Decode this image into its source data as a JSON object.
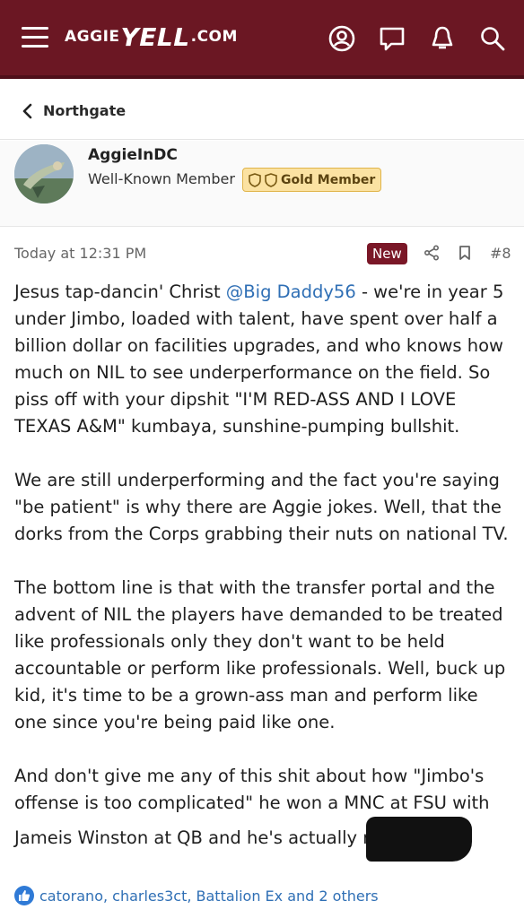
{
  "header": {
    "logo_left": "AGGIE",
    "logo_mid": "YELL",
    "logo_right": ".COM"
  },
  "breadcrumb": {
    "label": "Northgate"
  },
  "author": {
    "username": "AggieInDC",
    "title": "Well-Known Member",
    "badge": "Gold Member"
  },
  "post": {
    "timestamp": "Today at 12:31 PM",
    "new_label": "New",
    "post_number": "#8",
    "p1_before": "Jesus tap-dancin' Christ ",
    "p1_mention": "@Big Daddy56",
    "p1_after": " - we're in year 5 under Jimbo, loaded with talent, have spent over half a billion dollar on facilities upgrades, and who knows how much on NIL to see underperformance on the field. So piss off with your dipshit \"I'M RED-ASS AND I LOVE TEXAS A&M\" kumbaya, sunshine-pumping bullshit.",
    "p2": "We are still underperforming and the fact you're saying \"be patient\" is why there are Aggie jokes. Well, that the dorks from the Corps grabbing their nuts on national TV.",
    "p3": "The bottom line is that with the transfer portal and the advent of NIL the players have demanded to be treated like professionals only they don't want to be held accountable or perform like professionals. Well, buck up kid, it's time to be a grown-ass man and perform like one since you're being paid like one.",
    "p4": "And don't give me any of this shit about how \"Jimbo's offense is too complicated\" he won a MNC at FSU with Jameis Winston at QB and he's actually r"
  },
  "reactions": {
    "text": "catorano, charles3ct, Battalion Ex and 2 others"
  },
  "colors": {
    "header_bg": "#6b1723",
    "link": "#2f6fb5",
    "new_badge": "#7a1727",
    "gold_badge": "#fbe2a2"
  },
  "icons": [
    "menu-icon",
    "account-icon",
    "chat-icon",
    "bell-icon",
    "search-icon",
    "chevron-left-icon",
    "shield-icon",
    "share-icon",
    "bookmark-icon",
    "like-icon"
  ]
}
